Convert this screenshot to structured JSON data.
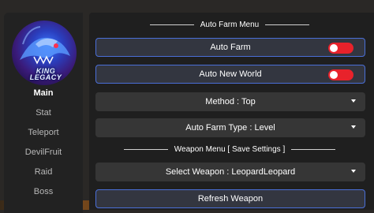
{
  "sidebar": {
    "logo_text": "KING LEGACY",
    "items": [
      {
        "label": "Main",
        "active": true
      },
      {
        "label": "Stat",
        "active": false
      },
      {
        "label": "Teleport",
        "active": false
      },
      {
        "label": "DevilFruit",
        "active": false
      },
      {
        "label": "Raid",
        "active": false
      },
      {
        "label": "Boss",
        "active": false
      }
    ]
  },
  "main": {
    "auto_farm_header": "Auto Farm Menu",
    "auto_farm": {
      "label": "Auto Farm",
      "enabled": true
    },
    "auto_new_world": {
      "label": "Auto New World",
      "enabled": true
    },
    "method_dropdown": {
      "label": "Method : Top"
    },
    "farm_type_dropdown": {
      "label": "Auto Farm Type : Level"
    },
    "weapon_header": "Weapon Menu [ Save Settings ]",
    "weapon_dropdown": {
      "label": "Select Weapon : LeopardLeopard"
    },
    "refresh_button": {
      "label": "Refresh Weapon"
    }
  },
  "colors": {
    "toggle_on": "#e8222b",
    "accent_border": "#4a6fd8",
    "panel_bg": "#1f1f1f",
    "row_bg": "#363636"
  }
}
